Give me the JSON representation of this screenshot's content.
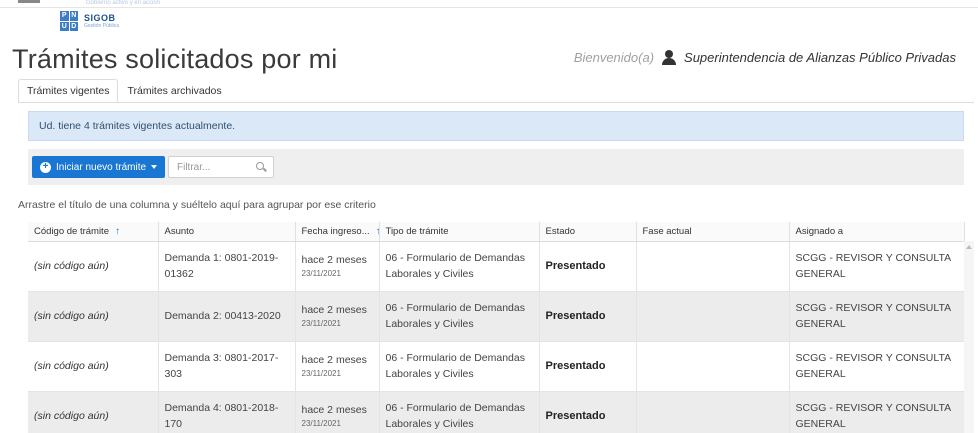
{
  "header": {
    "faint_text": "Gobierno activo y en acción",
    "logo_letters": [
      "P",
      "N",
      "U",
      "D"
    ],
    "logo_brand": "SIGOB",
    "logo_sub": "Gestión Pública"
  },
  "page": {
    "title": "Trámites solicitados por mi"
  },
  "welcome": {
    "greeting": "Bienvenido(a)",
    "user_icon": "user-icon",
    "user_name": "Superintendencia de Alianzas Público Privadas"
  },
  "tabs": [
    {
      "label": "Trámites vigentes",
      "active": true
    },
    {
      "label": "Trámites archivados",
      "active": false
    }
  ],
  "alert": {
    "text": "Ud. tiene 4 trámites vigentes actualmente."
  },
  "toolbar": {
    "new_button_label": "Iniciar nuevo trámite",
    "filter_placeholder": "Filtrar..."
  },
  "group_hint": "Arrastre el título de una columna y suéltelo aquí para agrupar por ese criterio",
  "columns": [
    {
      "label": "Código de trámite",
      "sorted": "asc"
    },
    {
      "label": "Asunto"
    },
    {
      "label": "Fecha ingreso...",
      "sorted": "asc"
    },
    {
      "label": "Tipo de trámite"
    },
    {
      "label": "Estado"
    },
    {
      "label": "Fase actual"
    },
    {
      "label": "Asignado a"
    }
  ],
  "rows": [
    {
      "code": "(sin código aún)",
      "asunto": "Demanda 1: 0801-2019-01362",
      "fecha_rel": "hace 2 meses",
      "fecha": "23/11/2021",
      "tipo": "06 - Formulario de Demandas Laborales y Civiles",
      "estado": "Presentado",
      "fase": "",
      "asignado": "SCGG - REVISOR Y CONSULTA GENERAL"
    },
    {
      "code": "(sin código aún)",
      "asunto": "Demanda 2: 00413-2020",
      "fecha_rel": "hace 2 meses",
      "fecha": "23/11/2021",
      "tipo": "06 - Formulario de Demandas Laborales y Civiles",
      "estado": "Presentado",
      "fase": "",
      "asignado": "SCGG - REVISOR Y CONSULTA GENERAL"
    },
    {
      "code": "(sin código aún)",
      "asunto": "Demanda 3: 0801-2017-303",
      "fecha_rel": "hace 2 meses",
      "fecha": "23/11/2021",
      "tipo": "06 - Formulario de Demandas Laborales y Civiles",
      "estado": "Presentado",
      "fase": "",
      "asignado": "SCGG - REVISOR Y CONSULTA GENERAL"
    },
    {
      "code": "(sin código aún)",
      "asunto": "Demanda 4: 0801-2018-170",
      "fecha_rel": "hace 2 meses",
      "fecha": "23/11/2021",
      "tipo": "06 - Formulario de Demandas Laborales y Civiles",
      "estado": "Presentado",
      "fase": "",
      "asignado": "SCGG - REVISOR Y CONSULTA GENERAL"
    }
  ],
  "colors": {
    "primary": "#1976d2",
    "alert_bg": "#dbe8f7",
    "alt_row": "#ececec"
  }
}
